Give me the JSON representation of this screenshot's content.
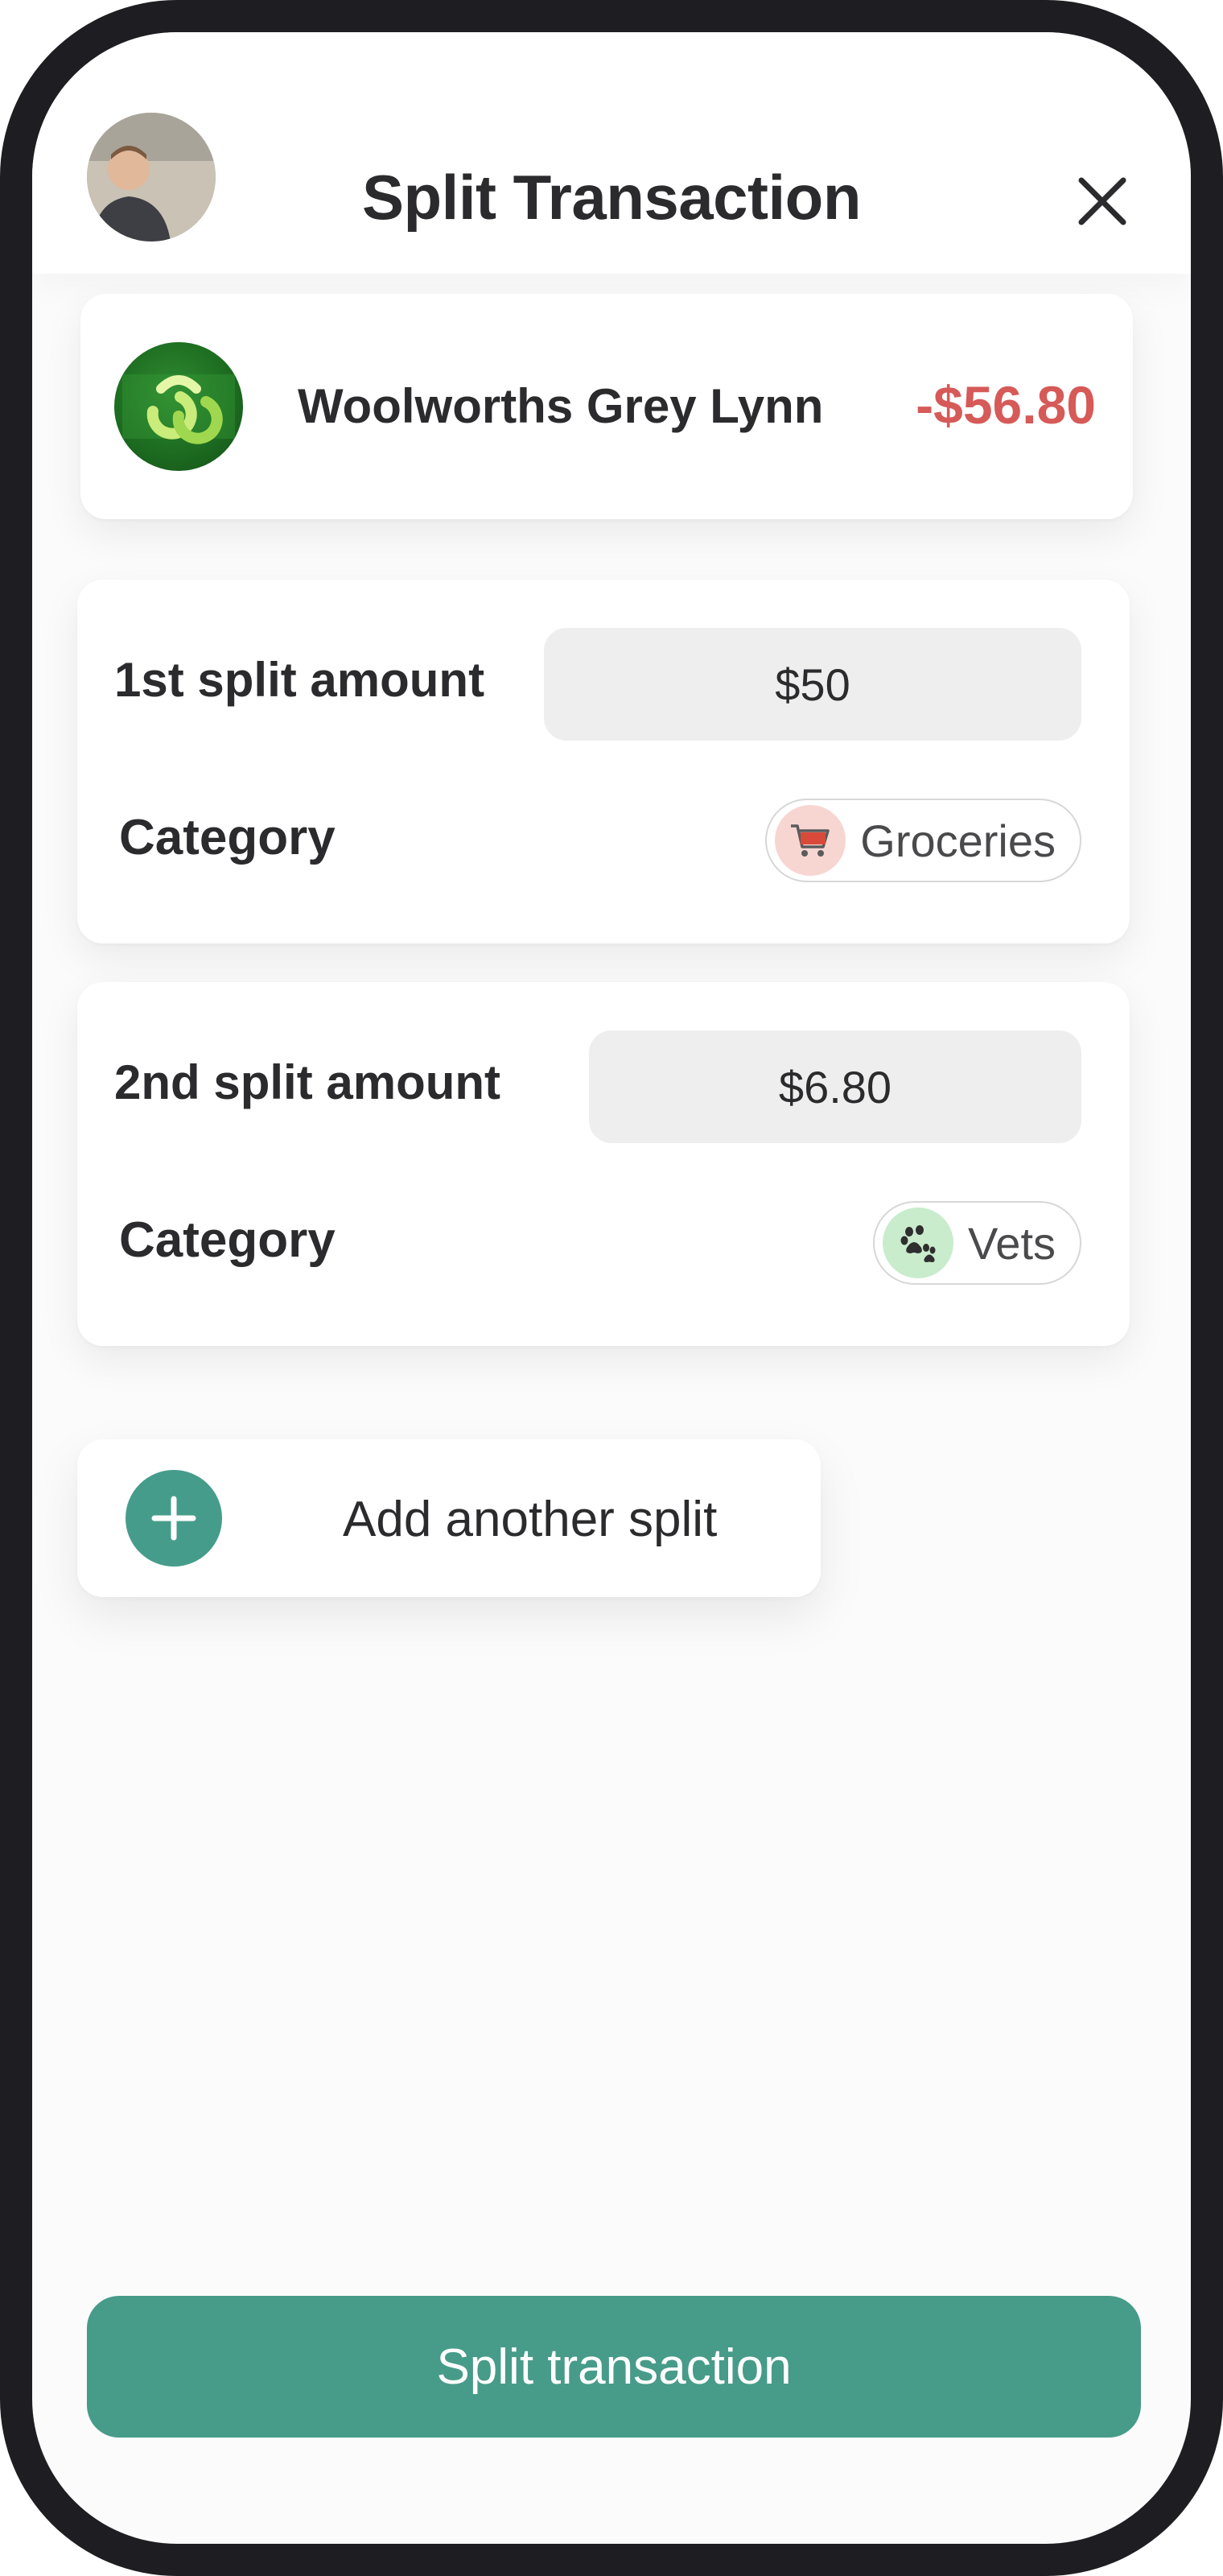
{
  "header": {
    "title": "Split Transaction",
    "avatar_icon": "user-avatar",
    "close_icon": "close-icon"
  },
  "transaction": {
    "merchant": "Woolworths Grey Lynn",
    "amount": "-$56.80",
    "amount_color": "#d65a58",
    "logo_icon": "woolworths-logo"
  },
  "splits": [
    {
      "label": "1st split amount",
      "amount": "$50",
      "category_label": "Category",
      "category": "Groceries",
      "category_icon": "shopping-cart-icon",
      "icon_bg": "#f7d6d2"
    },
    {
      "label": "2nd split amount",
      "amount": "$6.80",
      "category_label": "Category",
      "category": "Vets",
      "category_icon": "paw-print-icon",
      "icon_bg": "#c9eccd"
    }
  ],
  "add_split": {
    "label": "Add another split",
    "icon": "plus-icon"
  },
  "primary_action": {
    "label": "Split transaction"
  },
  "colors": {
    "accent": "#479b89",
    "negative": "#d65a58",
    "frame": "#1e1d21"
  }
}
